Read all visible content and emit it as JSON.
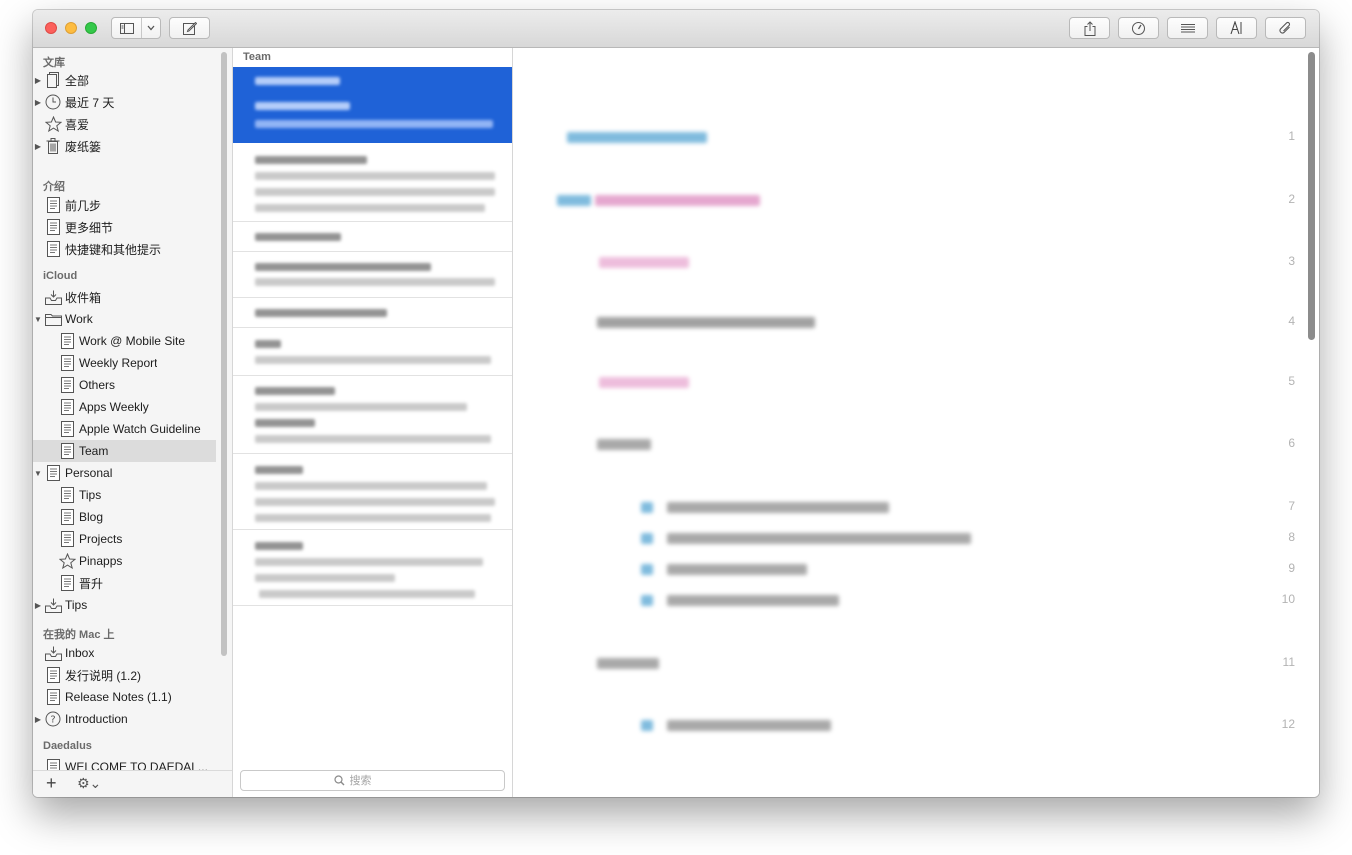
{
  "toolbar": {
    "sidebar_toggle_icon": "sidebar-icon",
    "compose_icon": "compose-icon",
    "share_icon": "share-icon",
    "stats_icon": "gauge-icon",
    "list_icon": "list-icon",
    "font_icon": "font-icon",
    "attach_icon": "paperclip-icon"
  },
  "sidebar": {
    "sections": {
      "library": "文库",
      "intro": "介绍",
      "icloud": "iCloud",
      "mac": "在我的 Mac 上",
      "daedalus": "Daedalus"
    },
    "items": [
      {
        "label": "全部",
        "icon": "book-icon"
      },
      {
        "label": "最近 7 天",
        "icon": "clock-icon"
      },
      {
        "label": "喜爱",
        "icon": "star-icon"
      },
      {
        "label": "废纸篓",
        "icon": "trash-icon"
      },
      {
        "label": "前几步",
        "icon": "document-icon"
      },
      {
        "label": "更多细节",
        "icon": "document-icon"
      },
      {
        "label": "快捷键和其他提示",
        "icon": "document-icon"
      },
      {
        "label": "收件箱",
        "icon": "inbox-icon"
      },
      {
        "label": "Work",
        "icon": "folder-icon"
      },
      {
        "label": "Work @ Mobile Site",
        "icon": "document-icon"
      },
      {
        "label": "Weekly Report",
        "icon": "document-icon"
      },
      {
        "label": "Others",
        "icon": "document-icon"
      },
      {
        "label": "Apps Weekly",
        "icon": "document-icon"
      },
      {
        "label": "Apple Watch Guideline",
        "icon": "document-icon"
      },
      {
        "label": "Team",
        "icon": "document-icon"
      },
      {
        "label": "Personal",
        "icon": "document-icon"
      },
      {
        "label": "Tips",
        "icon": "document-icon"
      },
      {
        "label": "Blog",
        "icon": "document-icon"
      },
      {
        "label": "Projects",
        "icon": "document-icon"
      },
      {
        "label": "Pinapps",
        "icon": "star-icon"
      },
      {
        "label": "晋升",
        "icon": "document-icon"
      },
      {
        "label": "Tips",
        "icon": "inbox-icon"
      },
      {
        "label": "Inbox",
        "icon": "inbox-icon"
      },
      {
        "label": "发行说明 (1.2)",
        "icon": "document-icon"
      },
      {
        "label": "Release Notes (1.1)",
        "icon": "document-icon"
      },
      {
        "label": "Introduction",
        "icon": "help-icon"
      },
      {
        "label": "WELCOME TO DAEDAL...",
        "icon": "document-icon"
      }
    ],
    "add_label": "+",
    "gear_label": "⚙⌄"
  },
  "notelist": {
    "title": "Team",
    "search_placeholder": "搜索"
  },
  "editor": {
    "line_numbers": [
      "1",
      "2",
      "3",
      "4",
      "5",
      "6",
      "7",
      "8",
      "9",
      "10",
      "11",
      "12"
    ]
  }
}
